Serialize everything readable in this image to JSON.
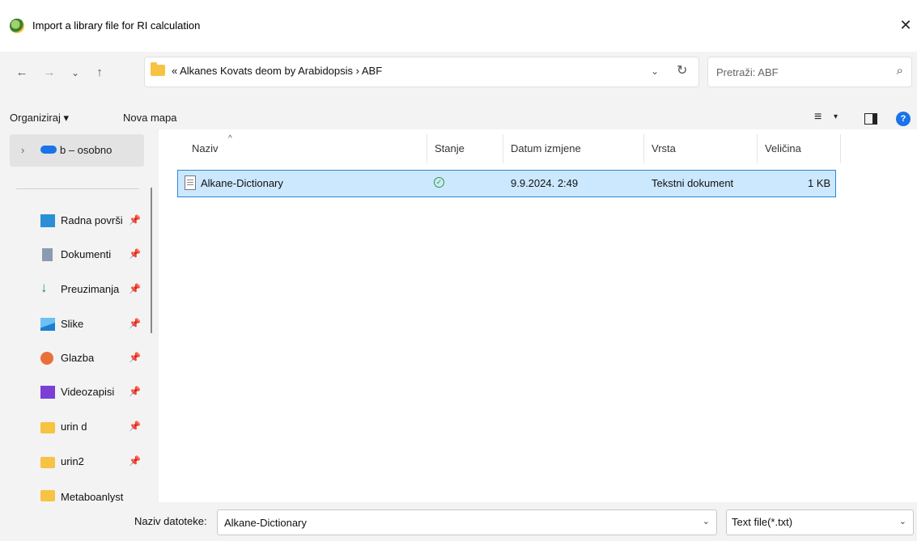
{
  "window": {
    "title": "Import a library file for RI calculation",
    "close_glyph": "✕"
  },
  "nav": {
    "back_glyph": "←",
    "forward_glyph": "→",
    "recent_glyph": "⌄",
    "up_glyph": "↑",
    "breadcrumb": "« Alkanes Kovats deom by Arabidopsis  ›  ABF",
    "address_dropdown_glyph": "⌄",
    "refresh_glyph": "↻",
    "search_placeholder": "Pretraži: ABF",
    "search_glyph": "⌕"
  },
  "toolbar": {
    "organize_label": "Organiziraj ▾",
    "new_folder_label": "Nova mapa",
    "view_glyph": "≡",
    "view_caret": "▾",
    "help_glyph": "?"
  },
  "sidebar": {
    "top_item": {
      "expand_glyph": "›",
      "label": "b – osobno",
      "icon": "cloud-icon",
      "icon_color": "#1a73e8"
    },
    "items": [
      {
        "label": "Radna površi",
        "icon": "desktop-icon",
        "color": "#2b8fd6",
        "pin": "📌"
      },
      {
        "label": "Dokumenti",
        "icon": "document-icon",
        "color": "#8a9bb0",
        "pin": "📌"
      },
      {
        "label": "Preuzimanja",
        "icon": "download-icon",
        "color": "#1f9a4a",
        "pin": "📌"
      },
      {
        "label": "Slike",
        "icon": "pictures-icon",
        "color": "#2b8fd6",
        "pin": "📌"
      },
      {
        "label": "Glazba",
        "icon": "music-icon",
        "color": "#e8703a",
        "pin": "📌"
      },
      {
        "label": "Videozapisi",
        "icon": "video-icon",
        "color": "#7b3fd6",
        "pin": "📌"
      },
      {
        "label": "urin d",
        "icon": "folder-icon",
        "color": "#f6c343",
        "pin": "📌"
      },
      {
        "label": "urin2",
        "icon": "folder-icon",
        "color": "#f6c343",
        "pin": "📌"
      },
      {
        "label": "Metaboanlyst",
        "icon": "folder-icon",
        "color": "#f6c343",
        "pin": ""
      }
    ]
  },
  "file_list": {
    "sort_glyph": "^",
    "columns": [
      "Naziv",
      "Stanje",
      "Datum izmjene",
      "Vrsta",
      "Veličina"
    ],
    "rows": [
      {
        "name": "Alkane-Dictionary",
        "status_glyph": "✓",
        "date": "9.9.2024. 2:49",
        "type": "Tekstni dokument",
        "size": "1 KB"
      }
    ]
  },
  "bottom": {
    "filename_label": "Naziv datoteke:",
    "filename_value": "Alkane-Dictionary",
    "filename_chevron": "⌄",
    "filetype_value": "Text file(*.txt)",
    "filetype_chevron": "⌄"
  }
}
